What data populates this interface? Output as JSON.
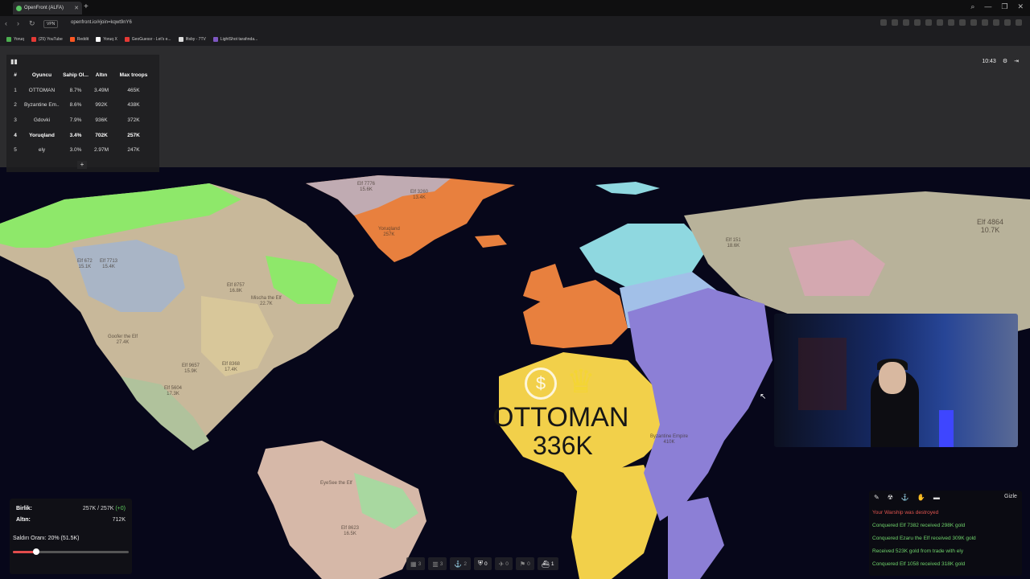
{
  "browser": {
    "tab_title": "OpenFront (ALFA)",
    "url": "openfront.io/#join=kqwt9nY6",
    "vpn_label": "VPN",
    "bookmarks": [
      {
        "label": "Yoruq",
        "color": "#4caf50"
      },
      {
        "label": "(25) YouTube",
        "color": "#e53935"
      },
      {
        "label": "Reddit",
        "color": "#ff5722"
      },
      {
        "label": "Yoruq X",
        "color": "#ffffff"
      },
      {
        "label": "GeoGuessr - Let's e...",
        "color": "#e53935"
      },
      {
        "label": "Ifisby - 7TV",
        "color": "#dddddd"
      },
      {
        "label": "LightShot tarafında...",
        "color": "#7e57c2"
      }
    ]
  },
  "leaderboard": {
    "headers": [
      "#",
      "Oyuncu",
      "Sahip Ol...",
      "Altın",
      "Max troops"
    ],
    "rows": [
      {
        "rank": "1",
        "player": "OTTOMAN",
        "owned": "8.7%",
        "gold": "3.49M",
        "troops": "465K",
        "me": false
      },
      {
        "rank": "2",
        "player": "Byzantine Em...",
        "owned": "8.6%",
        "gold": "992K",
        "troops": "438K",
        "me": false
      },
      {
        "rank": "3",
        "player": "Gdovki",
        "owned": "7.9%",
        "gold": "936K",
        "troops": "372K",
        "me": false
      },
      {
        "rank": "4",
        "player": "Yoruqland",
        "owned": "3.4%",
        "gold": "702K",
        "troops": "257K",
        "me": true
      },
      {
        "rank": "5",
        "player": "ely",
        "owned": "3.0%",
        "gold": "2.97M",
        "troops": "247K",
        "me": false
      }
    ],
    "expand_label": "+"
  },
  "top_right": {
    "timer": "10:43"
  },
  "map": {
    "highlight_name": "OTTOMAN",
    "highlight_troops": "336K",
    "labels": [
      {
        "text": "Elf 3260\n13.4K"
      },
      {
        "text": "Elf 7776\n15.6K"
      },
      {
        "text": "Yoruqland\n257K"
      },
      {
        "text": "Elf 4864\n10.7K"
      },
      {
        "text": "Elf 151\n18.6K"
      },
      {
        "text": "Elf 672\n15.1K"
      },
      {
        "text": "Elf 7713\n15.4K"
      },
      {
        "text": "Elf 8757\n16.8K"
      },
      {
        "text": "Mischa the Elf\n22.7K"
      },
      {
        "text": "Goofer the Elf\n27.4K"
      },
      {
        "text": "Elf 9657\n15.9K"
      },
      {
        "text": "Elf 8368\n17.4K"
      },
      {
        "text": "Elf 5604\n17.3K"
      },
      {
        "text": "Byzantine Empire\n410K"
      },
      {
        "text": "EyeSee the Elf"
      },
      {
        "text": "Elf 8623\n16.5K"
      }
    ]
  },
  "stats": {
    "troops_label": "Birlik:",
    "troops_value": "257K / 257K",
    "troops_delta": "(+0)",
    "gold_label": "Altın:",
    "gold_value": "712K",
    "attack_label": "Saldırı Oranı: 20% (51.5K)",
    "attack_ratio": 0.2
  },
  "toolbar": {
    "items": [
      {
        "value": "3",
        "active": false
      },
      {
        "value": "3",
        "active": false
      },
      {
        "value": "2",
        "active": false
      },
      {
        "value": "0",
        "active": true
      },
      {
        "value": "0",
        "active": false
      },
      {
        "value": "0",
        "active": false
      },
      {
        "value": "1",
        "active": true
      }
    ]
  },
  "events": {
    "hide_label": "Gizle",
    "messages": [
      {
        "text": "Your Warship was destroyed",
        "kind": "red"
      },
      {
        "text": "Conquered Elf 7382 received 298K gold",
        "kind": "green"
      },
      {
        "text": "Conquered Ezaru the Elf received 309K gold",
        "kind": "green"
      },
      {
        "text": "Received 523K gold from trade with ely",
        "kind": "green"
      },
      {
        "text": "Conquered Elf 1058 received 318K gold",
        "kind": "green"
      }
    ]
  },
  "colors": {
    "ottoman": "#f2d04a",
    "yoruqland": "#e8803e",
    "byzantine": "#8c7fd6",
    "ely": "#8ee86a",
    "ocean": "#07071a"
  }
}
